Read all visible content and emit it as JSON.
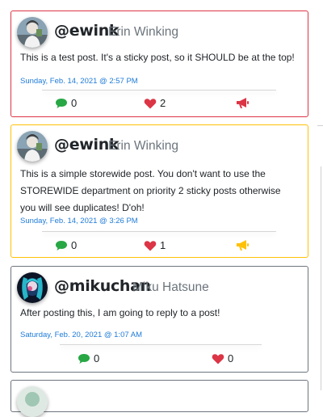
{
  "posts": [
    {
      "handle": "@ewink",
      "name": "Erin Winking",
      "body": "This is a test post. It's a sticky post, so it SHOULD be at the top!",
      "timestamp": "Sunday, Feb. 14, 2021 @ 2:57 PM",
      "comments": "0",
      "likes": "2",
      "border_color": "#dc3545",
      "announce_color": "#dc3545"
    },
    {
      "handle": "@ewink",
      "name": "Erin Winking",
      "body": "This is a simple storewide post. You don't want to use the STOREWIDE department on priority 2 sticky posts otherwise you will see duplicates! D'oh!",
      "timestamp": "Sunday, Feb. 14, 2021 @ 3:26 PM",
      "comments": "0",
      "likes": "1",
      "border_color": "#ffc107",
      "announce_color": "#ffc107"
    },
    {
      "handle": "@mikuchan",
      "name": "Miku Hatsune",
      "body": "After posting this, I am going to reply to a post!",
      "timestamp": "Saturday, Feb. 20, 2021 @ 1:07 AM",
      "comments": "0",
      "likes": "0",
      "border_color": "#6c757d"
    }
  ],
  "icons": {
    "comment": "comment-icon",
    "like": "heart-icon",
    "announce": "megaphone-icon"
  },
  "colors": {
    "comment": "#28a745",
    "like": "#dc3545",
    "link": "#1f7bd8"
  }
}
